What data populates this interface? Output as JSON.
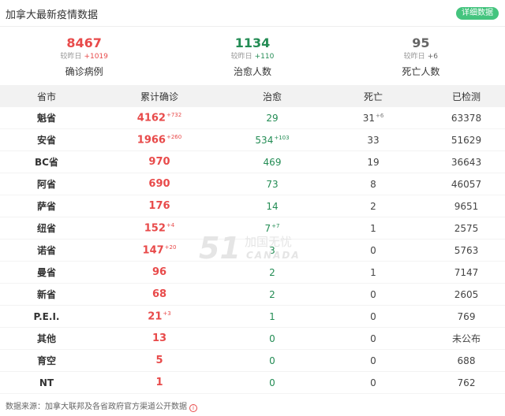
{
  "header": {
    "title": "加拿大最新疫情数据",
    "detail_button": "详细数据"
  },
  "stats": [
    {
      "value": "8467",
      "sub_prefix": "较昨日",
      "delta": "+1019",
      "label": "确诊病例",
      "color": "#e84a4a"
    },
    {
      "value": "1134",
      "sub_prefix": "较昨日",
      "delta": "+110",
      "label": "治愈人数",
      "color": "#238c54"
    },
    {
      "value": "95",
      "sub_prefix": "较昨日",
      "delta": "+6",
      "label": "死亡人数",
      "color": "#666666"
    }
  ],
  "table": {
    "headers": [
      "省市",
      "累计确诊",
      "治愈",
      "死亡",
      "已检测"
    ],
    "rows": [
      {
        "province": "魁省",
        "confirmed": "4162",
        "confirmed_delta": "+732",
        "cured": "29",
        "cured_delta": "",
        "deaths": "31",
        "deaths_delta": "+6",
        "tested": "63378"
      },
      {
        "province": "安省",
        "confirmed": "1966",
        "confirmed_delta": "+260",
        "cured": "534",
        "cured_delta": "+103",
        "deaths": "33",
        "deaths_delta": "",
        "tested": "51629"
      },
      {
        "province": "BC省",
        "confirmed": "970",
        "confirmed_delta": "",
        "cured": "469",
        "cured_delta": "",
        "deaths": "19",
        "deaths_delta": "",
        "tested": "36643"
      },
      {
        "province": "阿省",
        "confirmed": "690",
        "confirmed_delta": "",
        "cured": "73",
        "cured_delta": "",
        "deaths": "8",
        "deaths_delta": "",
        "tested": "46057"
      },
      {
        "province": "萨省",
        "confirmed": "176",
        "confirmed_delta": "",
        "cured": "14",
        "cured_delta": "",
        "deaths": "2",
        "deaths_delta": "",
        "tested": "9651"
      },
      {
        "province": "纽省",
        "confirmed": "152",
        "confirmed_delta": "+4",
        "cured": "7",
        "cured_delta": "+7",
        "deaths": "1",
        "deaths_delta": "",
        "tested": "2575"
      },
      {
        "province": "诺省",
        "confirmed": "147",
        "confirmed_delta": "+20",
        "cured": "3",
        "cured_delta": "",
        "deaths": "0",
        "deaths_delta": "",
        "tested": "5763"
      },
      {
        "province": "曼省",
        "confirmed": "96",
        "confirmed_delta": "",
        "cured": "2",
        "cured_delta": "",
        "deaths": "1",
        "deaths_delta": "",
        "tested": "7147"
      },
      {
        "province": "新省",
        "confirmed": "68",
        "confirmed_delta": "",
        "cured": "2",
        "cured_delta": "",
        "deaths": "0",
        "deaths_delta": "",
        "tested": "2605"
      },
      {
        "province": "P.E.I.",
        "confirmed": "21",
        "confirmed_delta": "+3",
        "cured": "1",
        "cured_delta": "",
        "deaths": "0",
        "deaths_delta": "",
        "tested": "769"
      },
      {
        "province": "其他",
        "confirmed": "13",
        "confirmed_delta": "",
        "cured": "0",
        "cured_delta": "",
        "deaths": "0",
        "deaths_delta": "",
        "tested": "未公布"
      },
      {
        "province": "育空",
        "confirmed": "5",
        "confirmed_delta": "",
        "cured": "0",
        "cured_delta": "",
        "deaths": "0",
        "deaths_delta": "",
        "tested": "688"
      },
      {
        "province": "NT",
        "confirmed": "1",
        "confirmed_delta": "",
        "cured": "0",
        "cured_delta": "",
        "deaths": "0",
        "deaths_delta": "",
        "tested": "762"
      }
    ]
  },
  "watermark": {
    "number": "51",
    "cn": "加国无忧",
    "en": "CANADA"
  },
  "footer": {
    "source": "数据来源：加拿大联邦及各省政府官方渠道公开数据",
    "info_icon": "info-icon"
  }
}
